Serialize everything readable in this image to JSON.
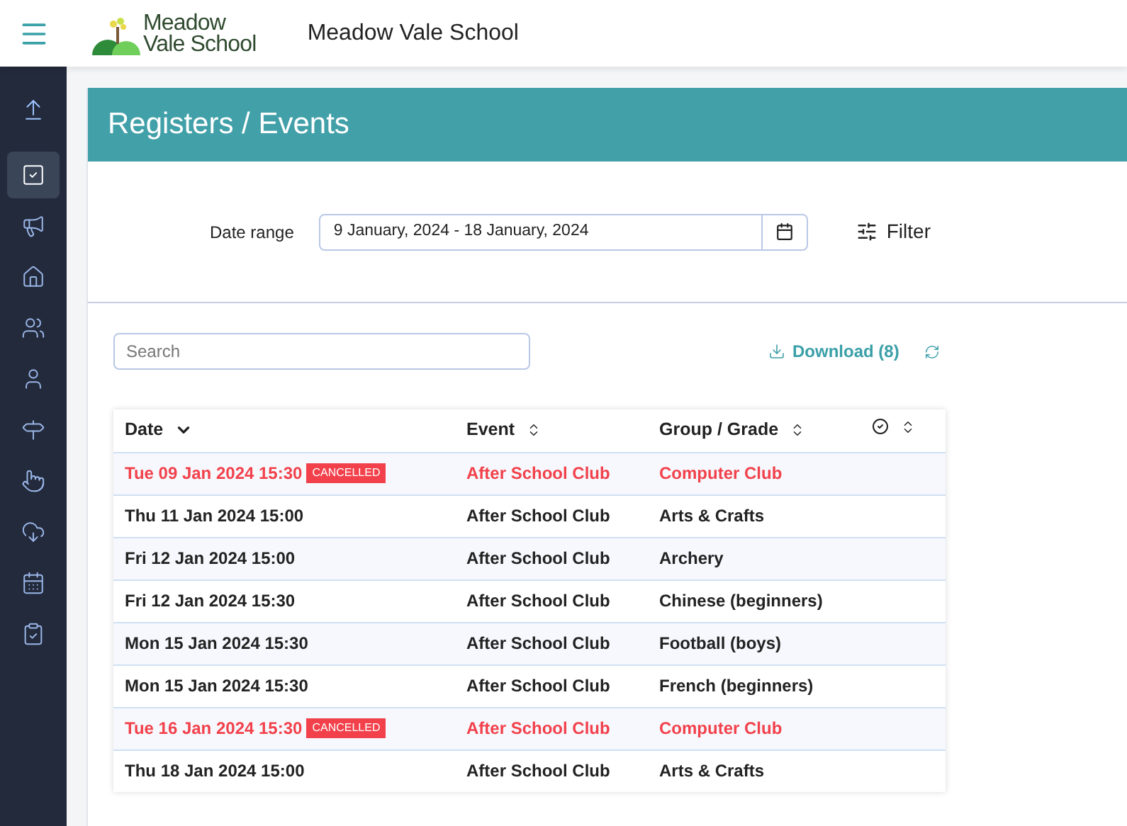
{
  "header": {
    "logo_line_1": "Meadow",
    "logo_line_2": "Vale School",
    "school_name": "Meadow Vale School"
  },
  "sidebar": {
    "items": [
      {
        "selected": false
      },
      {
        "selected": true
      },
      {
        "selected": false
      },
      {
        "selected": false
      },
      {
        "selected": false
      },
      {
        "selected": false
      },
      {
        "selected": false
      },
      {
        "selected": false
      },
      {
        "selected": false
      },
      {
        "selected": false
      },
      {
        "selected": false
      }
    ]
  },
  "page_title": "Registers / Events",
  "filters": {
    "date_range_label": "Date range",
    "date_range_value": "9 January, 2024 - 18 January, 2024",
    "filter_label": "Filter"
  },
  "search": {
    "placeholder": "Search"
  },
  "download_label": "Download (8)",
  "table": {
    "columns": [
      {
        "kind": "text",
        "label": "Date",
        "sorted": true
      },
      {
        "kind": "text",
        "label": "Event",
        "sorted": false
      },
      {
        "kind": "text",
        "label": "Group / Grade",
        "sorted": false
      },
      {
        "kind": "icon",
        "sorted": false
      }
    ],
    "rows": [
      {
        "date": "Tue 09 Jan 2024 15:30",
        "cancelled": true,
        "badge": "CANCELLED",
        "event": "After School Club",
        "group": "Computer Club"
      },
      {
        "date": "Thu 11 Jan 2024 15:00",
        "cancelled": false,
        "event": "After School Club",
        "group": "Arts & Crafts"
      },
      {
        "date": "Fri 12 Jan 2024 15:00",
        "cancelled": false,
        "event": "After School Club",
        "group": "Archery"
      },
      {
        "date": "Fri 12 Jan 2024 15:30",
        "cancelled": false,
        "event": "After School Club",
        "group": "Chinese (beginners)"
      },
      {
        "date": "Mon 15 Jan 2024 15:30",
        "cancelled": false,
        "event": "After School Club",
        "group": "Football (boys)"
      },
      {
        "date": "Mon 15 Jan 2024 15:30",
        "cancelled": false,
        "event": "After School Club",
        "group": "French (beginners)"
      },
      {
        "date": "Tue 16 Jan 2024 15:30",
        "cancelled": true,
        "badge": "CANCELLED",
        "event": "After School Club",
        "group": "Computer Club"
      },
      {
        "date": "Thu 18 Jan 2024 15:00",
        "cancelled": false,
        "event": "After School Club",
        "group": "Arts & Crafts"
      }
    ]
  }
}
